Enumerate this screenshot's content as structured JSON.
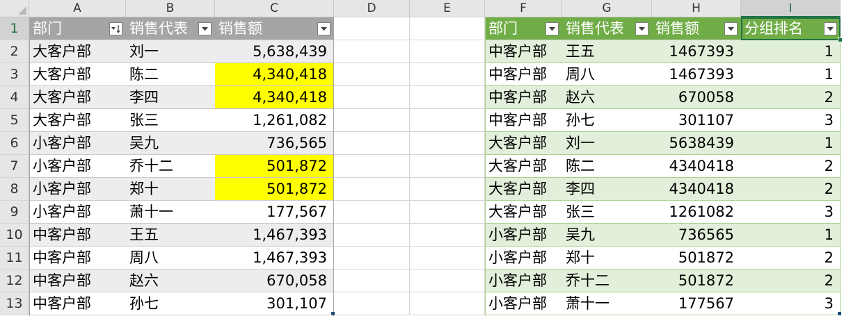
{
  "columns": [
    "A",
    "B",
    "C",
    "D",
    "E",
    "F",
    "G",
    "H",
    "I"
  ],
  "rows": [
    "1",
    "2",
    "3",
    "4",
    "5",
    "6",
    "7",
    "8",
    "9",
    "10",
    "11",
    "12",
    "13"
  ],
  "left_table": {
    "headers": [
      "部门",
      "销售代表",
      "销售额"
    ],
    "filter_states": [
      "sorted-ascending",
      "dropdown",
      "dropdown"
    ],
    "header_color": "#a5a5a5",
    "band_color": "#ededed",
    "highlight_color": "#ffff00",
    "rows": [
      {
        "dept": "大客户部",
        "rep": "刘一",
        "sales": "5,638,439",
        "highlight": false
      },
      {
        "dept": "大客户部",
        "rep": "陈二",
        "sales": "4,340,418",
        "highlight": true
      },
      {
        "dept": "大客户部",
        "rep": "李四",
        "sales": "4,340,418",
        "highlight": true
      },
      {
        "dept": "大客户部",
        "rep": "张三",
        "sales": "1,261,082",
        "highlight": false
      },
      {
        "dept": "小客户部",
        "rep": "吴九",
        "sales": "736,565",
        "highlight": false
      },
      {
        "dept": "小客户部",
        "rep": "乔十二",
        "sales": "501,872",
        "highlight": true
      },
      {
        "dept": "小客户部",
        "rep": "郑十",
        "sales": "501,872",
        "highlight": true
      },
      {
        "dept": "小客户部",
        "rep": "萧十一",
        "sales": "177,567",
        "highlight": false
      },
      {
        "dept": "中客户部",
        "rep": "王五",
        "sales": "1,467,393",
        "highlight": false
      },
      {
        "dept": "中客户部",
        "rep": "周八",
        "sales": "1,467,393",
        "highlight": false
      },
      {
        "dept": "中客户部",
        "rep": "赵六",
        "sales": "670,058",
        "highlight": false
      },
      {
        "dept": "中客户部",
        "rep": "孙七",
        "sales": "301,107",
        "highlight": false
      }
    ]
  },
  "right_table": {
    "headers": [
      "部门",
      "销售代表",
      "销售额",
      "分组排名"
    ],
    "header_color": "#70ad47",
    "band_color": "#e2efda",
    "rows": [
      {
        "dept": "中客户部",
        "rep": "王五",
        "sales": "1467393",
        "rank": "1"
      },
      {
        "dept": "中客户部",
        "rep": "周八",
        "sales": "1467393",
        "rank": "1"
      },
      {
        "dept": "中客户部",
        "rep": "赵六",
        "sales": "670058",
        "rank": "2"
      },
      {
        "dept": "中客户部",
        "rep": "孙七",
        "sales": "301107",
        "rank": "3"
      },
      {
        "dept": "大客户部",
        "rep": "刘一",
        "sales": "5638439",
        "rank": "1"
      },
      {
        "dept": "大客户部",
        "rep": "陈二",
        "sales": "4340418",
        "rank": "2"
      },
      {
        "dept": "大客户部",
        "rep": "李四",
        "sales": "4340418",
        "rank": "2"
      },
      {
        "dept": "大客户部",
        "rep": "张三",
        "sales": "1261082",
        "rank": "3"
      },
      {
        "dept": "小客户部",
        "rep": "吴九",
        "sales": "736565",
        "rank": "1"
      },
      {
        "dept": "小客户部",
        "rep": "郑十",
        "sales": "501872",
        "rank": "2"
      },
      {
        "dept": "小客户部",
        "rep": "乔十二",
        "sales": "501872",
        "rank": "2"
      },
      {
        "dept": "小客户部",
        "rep": "萧十一",
        "sales": "177567",
        "rank": "3"
      }
    ]
  },
  "selection": {
    "active_cell": "I1",
    "accent": "#217346"
  }
}
